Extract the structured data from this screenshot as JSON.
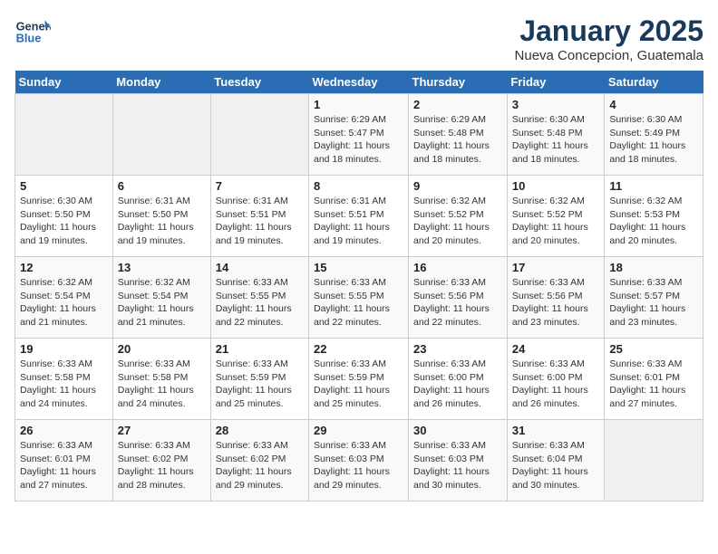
{
  "logo": {
    "line1": "General",
    "line2": "Blue"
  },
  "title": "January 2025",
  "subtitle": "Nueva Concepcion, Guatemala",
  "days_of_week": [
    "Sunday",
    "Monday",
    "Tuesday",
    "Wednesday",
    "Thursday",
    "Friday",
    "Saturday"
  ],
  "weeks": [
    [
      {
        "day": "",
        "info": ""
      },
      {
        "day": "",
        "info": ""
      },
      {
        "day": "",
        "info": ""
      },
      {
        "day": "1",
        "info": "Sunrise: 6:29 AM\nSunset: 5:47 PM\nDaylight: 11 hours and 18 minutes."
      },
      {
        "day": "2",
        "info": "Sunrise: 6:29 AM\nSunset: 5:48 PM\nDaylight: 11 hours and 18 minutes."
      },
      {
        "day": "3",
        "info": "Sunrise: 6:30 AM\nSunset: 5:48 PM\nDaylight: 11 hours and 18 minutes."
      },
      {
        "day": "4",
        "info": "Sunrise: 6:30 AM\nSunset: 5:49 PM\nDaylight: 11 hours and 18 minutes."
      }
    ],
    [
      {
        "day": "5",
        "info": "Sunrise: 6:30 AM\nSunset: 5:50 PM\nDaylight: 11 hours and 19 minutes."
      },
      {
        "day": "6",
        "info": "Sunrise: 6:31 AM\nSunset: 5:50 PM\nDaylight: 11 hours and 19 minutes."
      },
      {
        "day": "7",
        "info": "Sunrise: 6:31 AM\nSunset: 5:51 PM\nDaylight: 11 hours and 19 minutes."
      },
      {
        "day": "8",
        "info": "Sunrise: 6:31 AM\nSunset: 5:51 PM\nDaylight: 11 hours and 19 minutes."
      },
      {
        "day": "9",
        "info": "Sunrise: 6:32 AM\nSunset: 5:52 PM\nDaylight: 11 hours and 20 minutes."
      },
      {
        "day": "10",
        "info": "Sunrise: 6:32 AM\nSunset: 5:52 PM\nDaylight: 11 hours and 20 minutes."
      },
      {
        "day": "11",
        "info": "Sunrise: 6:32 AM\nSunset: 5:53 PM\nDaylight: 11 hours and 20 minutes."
      }
    ],
    [
      {
        "day": "12",
        "info": "Sunrise: 6:32 AM\nSunset: 5:54 PM\nDaylight: 11 hours and 21 minutes."
      },
      {
        "day": "13",
        "info": "Sunrise: 6:32 AM\nSunset: 5:54 PM\nDaylight: 11 hours and 21 minutes."
      },
      {
        "day": "14",
        "info": "Sunrise: 6:33 AM\nSunset: 5:55 PM\nDaylight: 11 hours and 22 minutes."
      },
      {
        "day": "15",
        "info": "Sunrise: 6:33 AM\nSunset: 5:55 PM\nDaylight: 11 hours and 22 minutes."
      },
      {
        "day": "16",
        "info": "Sunrise: 6:33 AM\nSunset: 5:56 PM\nDaylight: 11 hours and 22 minutes."
      },
      {
        "day": "17",
        "info": "Sunrise: 6:33 AM\nSunset: 5:56 PM\nDaylight: 11 hours and 23 minutes."
      },
      {
        "day": "18",
        "info": "Sunrise: 6:33 AM\nSunset: 5:57 PM\nDaylight: 11 hours and 23 minutes."
      }
    ],
    [
      {
        "day": "19",
        "info": "Sunrise: 6:33 AM\nSunset: 5:58 PM\nDaylight: 11 hours and 24 minutes."
      },
      {
        "day": "20",
        "info": "Sunrise: 6:33 AM\nSunset: 5:58 PM\nDaylight: 11 hours and 24 minutes."
      },
      {
        "day": "21",
        "info": "Sunrise: 6:33 AM\nSunset: 5:59 PM\nDaylight: 11 hours and 25 minutes."
      },
      {
        "day": "22",
        "info": "Sunrise: 6:33 AM\nSunset: 5:59 PM\nDaylight: 11 hours and 25 minutes."
      },
      {
        "day": "23",
        "info": "Sunrise: 6:33 AM\nSunset: 6:00 PM\nDaylight: 11 hours and 26 minutes."
      },
      {
        "day": "24",
        "info": "Sunrise: 6:33 AM\nSunset: 6:00 PM\nDaylight: 11 hours and 26 minutes."
      },
      {
        "day": "25",
        "info": "Sunrise: 6:33 AM\nSunset: 6:01 PM\nDaylight: 11 hours and 27 minutes."
      }
    ],
    [
      {
        "day": "26",
        "info": "Sunrise: 6:33 AM\nSunset: 6:01 PM\nDaylight: 11 hours and 27 minutes."
      },
      {
        "day": "27",
        "info": "Sunrise: 6:33 AM\nSunset: 6:02 PM\nDaylight: 11 hours and 28 minutes."
      },
      {
        "day": "28",
        "info": "Sunrise: 6:33 AM\nSunset: 6:02 PM\nDaylight: 11 hours and 29 minutes."
      },
      {
        "day": "29",
        "info": "Sunrise: 6:33 AM\nSunset: 6:03 PM\nDaylight: 11 hours and 29 minutes."
      },
      {
        "day": "30",
        "info": "Sunrise: 6:33 AM\nSunset: 6:03 PM\nDaylight: 11 hours and 30 minutes."
      },
      {
        "day": "31",
        "info": "Sunrise: 6:33 AM\nSunset: 6:04 PM\nDaylight: 11 hours and 30 minutes."
      },
      {
        "day": "",
        "info": ""
      }
    ]
  ]
}
